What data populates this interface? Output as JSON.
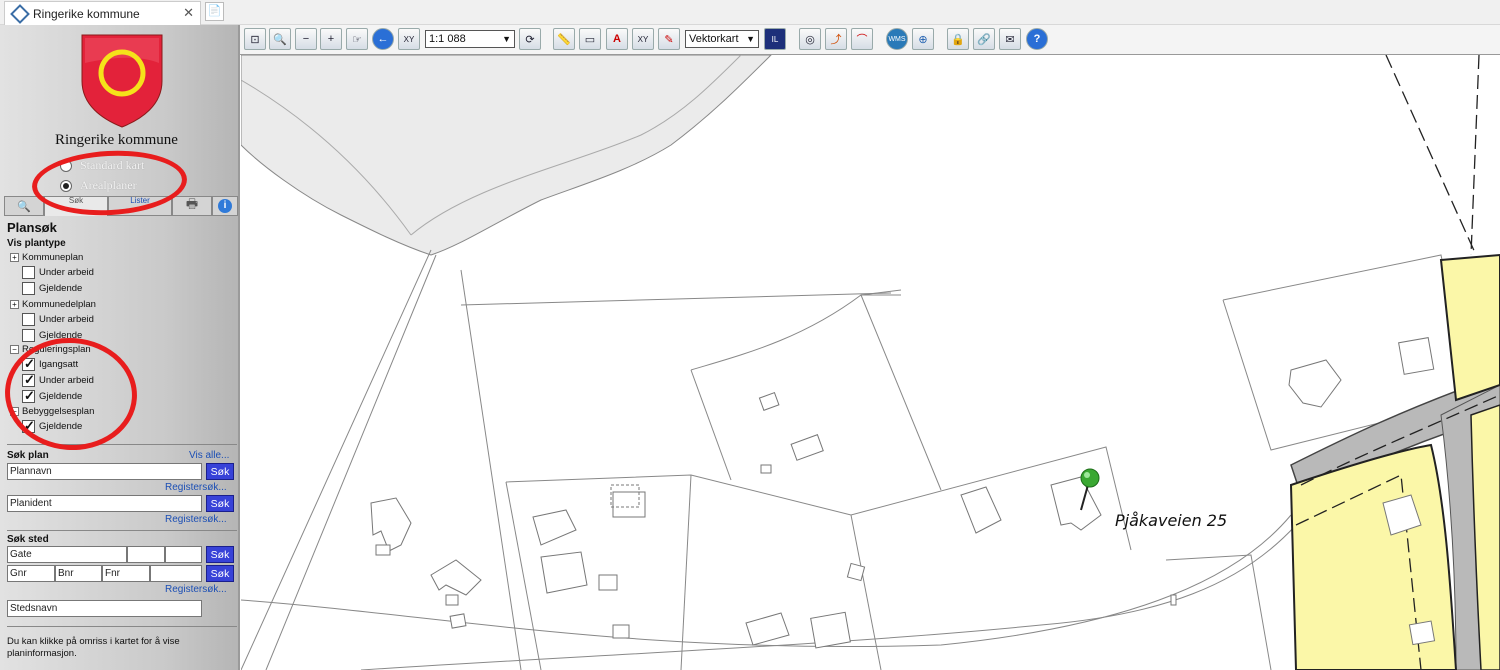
{
  "browser": {
    "tab_title": "Ringerike kommune",
    "close_glyph": "✕",
    "new_tab_glyph": "📄"
  },
  "sidebar": {
    "kommune_name": "Ringerike kommune",
    "map_mode": [
      {
        "label": "Standard kart",
        "selected": false
      },
      {
        "label": "Arealplaner",
        "selected": true
      }
    ],
    "tabs": [
      "search-icon",
      "Søk",
      "Lister",
      "print-icon",
      "info-icon"
    ],
    "info_glyph": "i",
    "search_glyph": "🔍",
    "print_glyph": "🖶"
  },
  "plansok": {
    "title": "Plansøk",
    "vis_plantype": "Vis plantype",
    "groups": [
      {
        "name": "Kommuneplan",
        "expand": "+",
        "items": [
          {
            "label": "Under arbeid",
            "checked": false
          },
          {
            "label": "Gjeldende",
            "checked": false
          }
        ]
      },
      {
        "name": "Kommunedelplan",
        "expand": "+",
        "items": [
          {
            "label": "Under arbeid",
            "checked": false
          },
          {
            "label": "Gjeldende",
            "checked": false
          }
        ]
      },
      {
        "name": "Reguleringsplan",
        "expand": "−",
        "items": [
          {
            "label": "Igangsatt",
            "checked": true
          },
          {
            "label": "Under arbeid",
            "checked": true
          },
          {
            "label": "Gjeldende",
            "checked": true
          }
        ]
      },
      {
        "name": "Bebyggelsesplan",
        "expand": "−",
        "items": [
          {
            "label": "Gjeldende",
            "checked": true
          }
        ]
      }
    ]
  },
  "sok_plan": {
    "title": "Søk plan",
    "vis_alle": "Vis alle...",
    "plannavn": "Plannavn",
    "planident": "Planident",
    "sok_btn": "Søk",
    "registersok": "Registersøk..."
  },
  "sok_sted": {
    "title": "Søk sted",
    "gate": "Gate",
    "gnr": "Gnr",
    "bnr": "Bnr",
    "fnr": "Fnr",
    "stedsnavn": "Stedsnavn",
    "sok_btn": "Søk",
    "registersok": "Registersøk..."
  },
  "hint": "Du kan klikke på omriss i kartet for å vise planinformasjon.",
  "toolbar": {
    "scale": "1:1 088",
    "map_type": "Vektorkart",
    "dropdown_glyph": "▼",
    "icons": {
      "full-extent": "⊡",
      "zoom-window": "🔍",
      "zoom-out": "−",
      "zoom-in": "+",
      "pan": "☞",
      "back": "←",
      "xy": "XY",
      "refresh": "⟳",
      "measure": "📏",
      "area": "▭",
      "label": "A",
      "xy2": "XY",
      "draw": "✎",
      "infoland": "IL",
      "binoculars": "◎",
      "profile": "⌒",
      "elevation": "⤴",
      "wms": "WMS",
      "globe": "⊕",
      "lock": "🔒",
      "link": "🔗",
      "mail": "✉",
      "help": "?"
    }
  },
  "map": {
    "address_label": "Pjåkaveien 25"
  },
  "colors": {
    "zone_yellow": "#fbf7a8",
    "road_gray": "#b9b9b9",
    "water_gray": "#ebebeb",
    "marker_green": "#3aa832",
    "annotation_red": "#e81d1d",
    "button_blue": "#3742d8"
  }
}
